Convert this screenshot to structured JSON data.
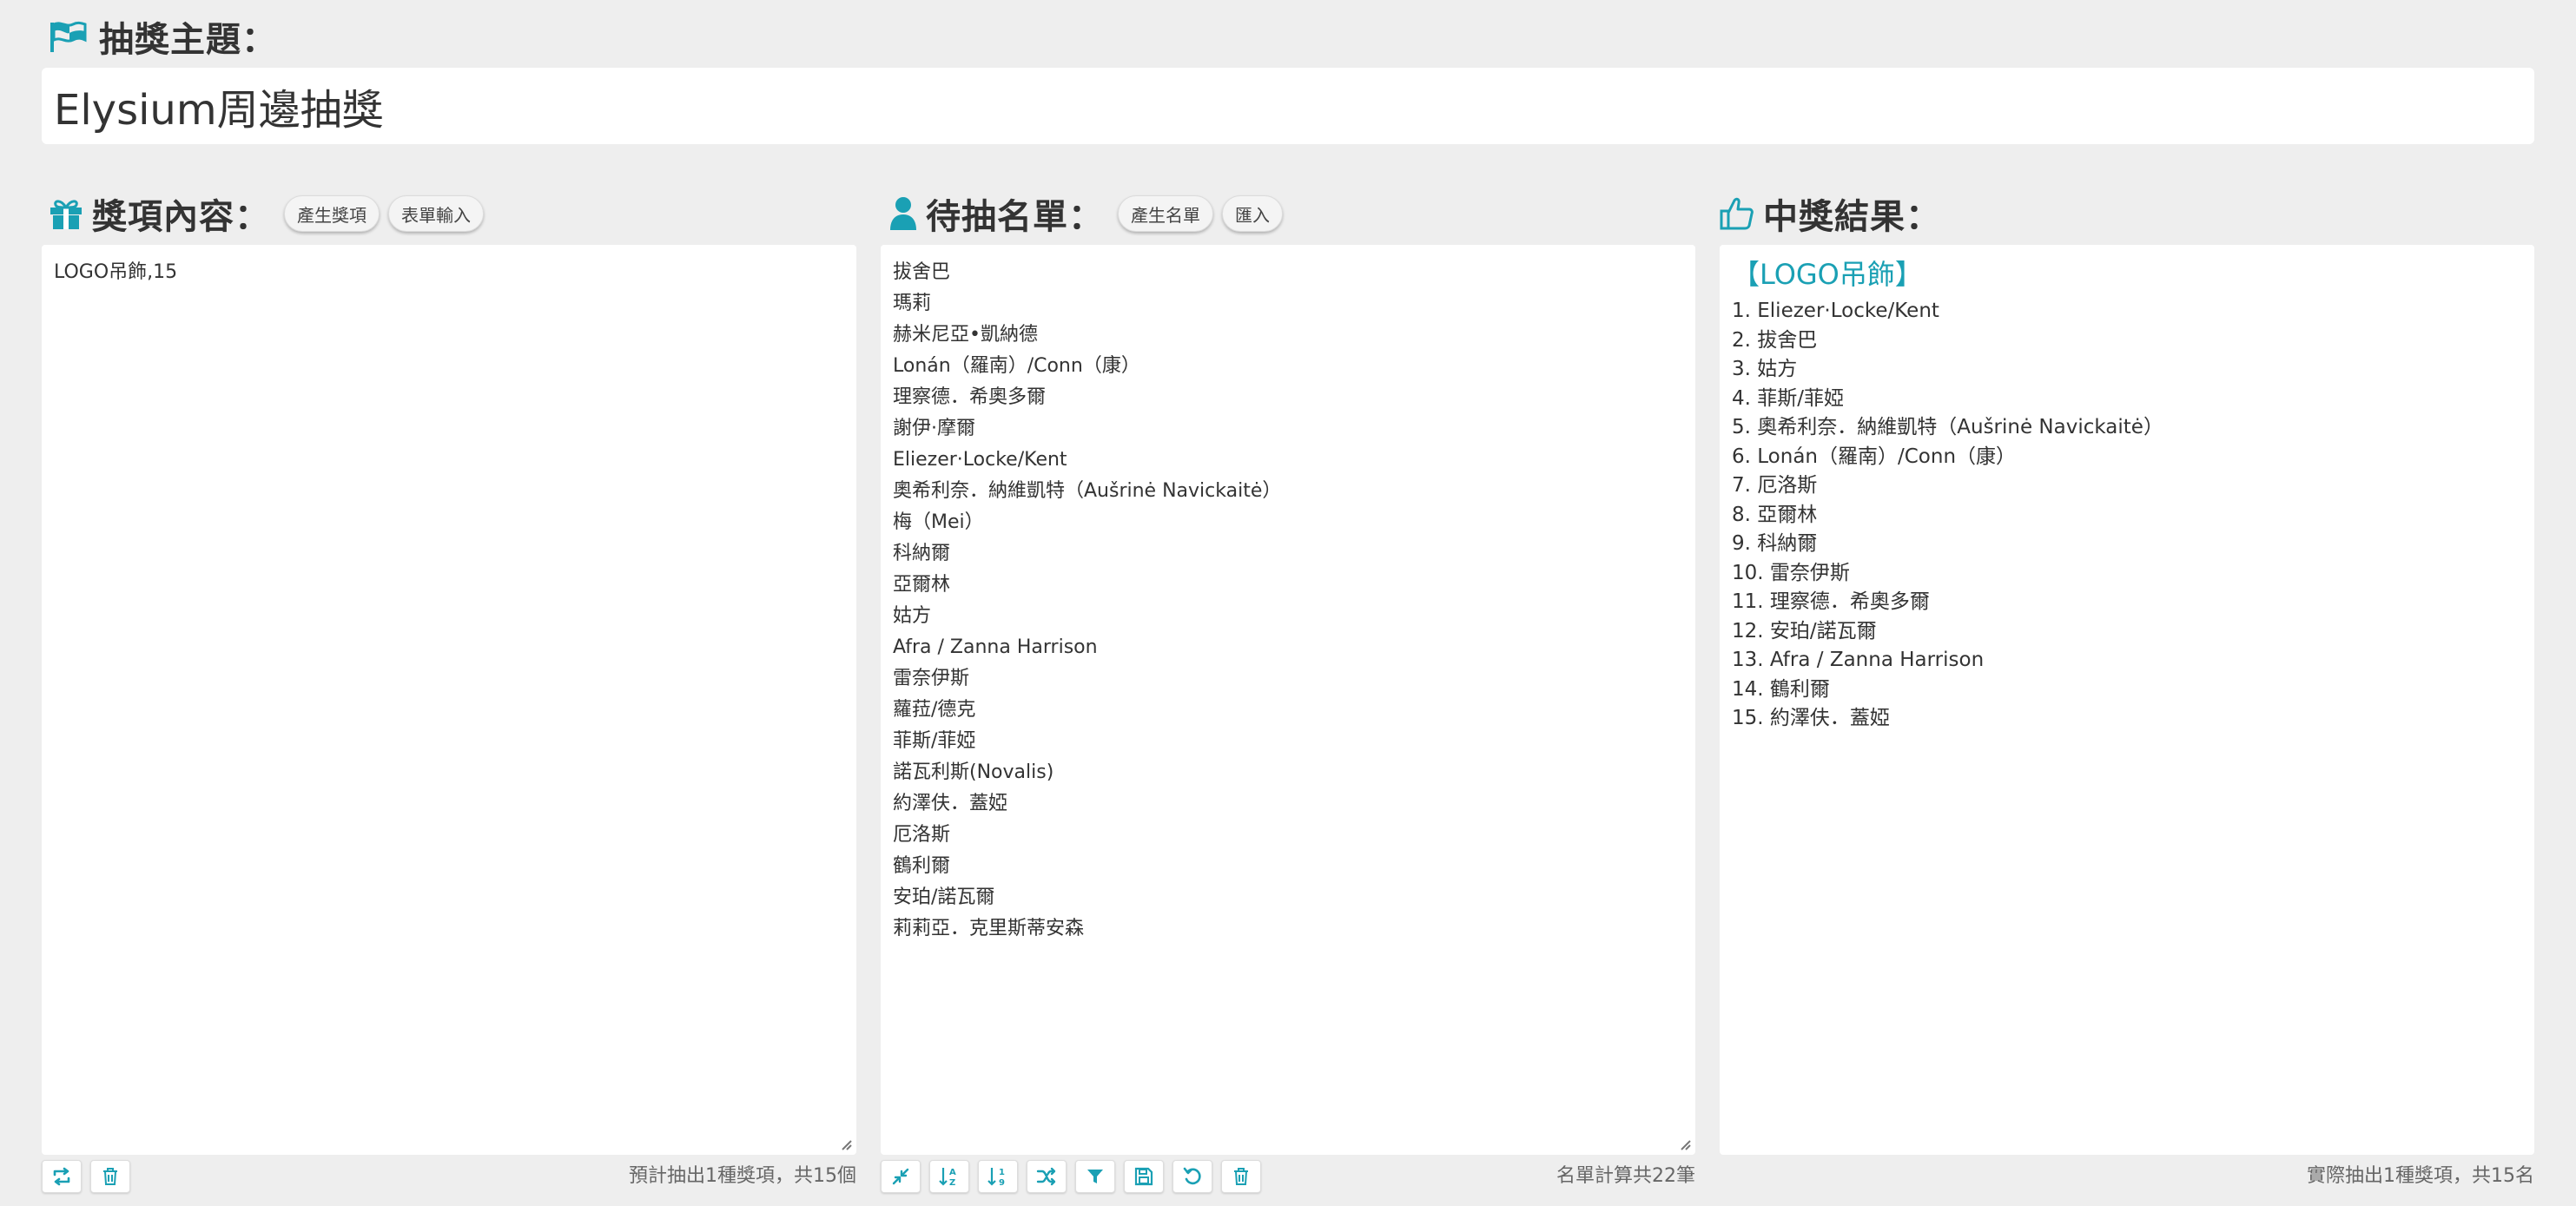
{
  "colors": {
    "accent": "#1aa0b4",
    "background": "#eeeeee",
    "panel": "#ffffff"
  },
  "theme": {
    "icon": "flag-icon",
    "title": "抽獎主題：",
    "value": "Elysium周邊抽獎"
  },
  "prizes": {
    "icon": "gift-icon",
    "title": "獎項內容：",
    "buttons": {
      "generate": "產生獎項",
      "form_input": "表單輸入"
    },
    "content": "LOGO吊飾,15",
    "toolbar_icons": [
      "swap-icon",
      "trash-icon"
    ],
    "footnote": "預計抽出1種獎項，共15個"
  },
  "candidates": {
    "icon": "user-icon",
    "title": "待抽名單：",
    "buttons": {
      "generate": "產生名單",
      "import": "匯入"
    },
    "names": [
      "拔舍巴",
      "瑪莉",
      "赫米尼亞•凱納德",
      "Lonán（羅南）/Conn（康）",
      "理察德．希奧多爾",
      "謝伊·摩爾",
      "Eliezer·Locke/Kent",
      "奧希利奈．納維凱特（Aušrinė Navickaitė）",
      "梅（Mei）",
      "科納爾",
      "亞爾林",
      "姑方",
      "Afra / Zanna Harrison",
      "雷奈伊斯",
      "蘿菈/德克",
      "菲斯/菲婭",
      "諾瓦利斯(Novalis)",
      "約澤伕．蓋婭",
      "厄洛斯",
      "鶴利爾",
      "安珀/諾瓦爾",
      "莉莉亞．克里斯蒂安森"
    ],
    "toolbar_icons": [
      "compress-icon",
      "sort-alpha-icon",
      "sort-numeric-icon",
      "shuffle-icon",
      "filter-icon",
      "save-icon",
      "undo-icon",
      "trash-icon"
    ],
    "footnote": "名單計算共22筆"
  },
  "results": {
    "icon": "thumbs-up-icon",
    "title": "中獎結果：",
    "group_label": "【LOGO吊飾】",
    "winners": [
      "1. Eliezer·Locke/Kent",
      "2. 拔舍巴",
      "3. 姑方",
      "4. 菲斯/菲婭",
      "5. 奧希利奈．納維凱特（Aušrinė Navickaitė）",
      "6. Lonán（羅南）/Conn（康）",
      "7. 厄洛斯",
      "8. 亞爾林",
      "9. 科納爾",
      "10. 雷奈伊斯",
      "11. 理察德．希奧多爾",
      "12. 安珀/諾瓦爾",
      "13. Afra / Zanna Harrison",
      "14. 鶴利爾",
      "15. 約澤伕．蓋婭"
    ],
    "footnote": "實際抽出1種獎項，共15名"
  }
}
